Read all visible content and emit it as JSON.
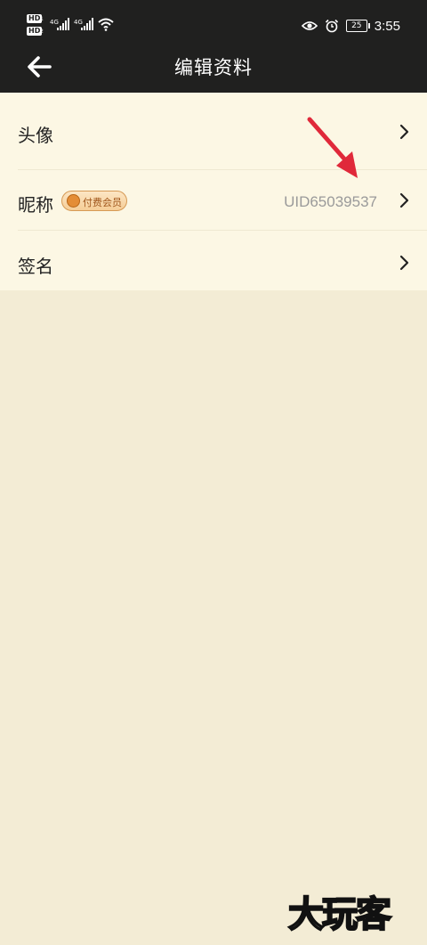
{
  "status_bar": {
    "hd1": "HD",
    "hd2": "HD",
    "sim1_slot": "1",
    "sim2_slot": "2",
    "network1": "4G",
    "network2": "4G",
    "battery": "25",
    "time": "3:55",
    "icons": [
      "signal-icon",
      "wifi-icon",
      "eye-icon",
      "alarm-icon",
      "battery-icon"
    ]
  },
  "header": {
    "title": "编辑资料",
    "back_icon": "back-arrow-icon"
  },
  "rows": [
    {
      "label": "头像",
      "icon": "chevron-right-icon"
    },
    {
      "label": "昵称",
      "badge": "付费会员",
      "value": "UID65039537",
      "icon": "chevron-right-icon"
    },
    {
      "label": "签名",
      "icon": "chevron-right-icon"
    }
  ],
  "annotation": {
    "icon": "red-arrow-icon",
    "color": "#e0293a"
  },
  "watermark": "大玩客",
  "colors": {
    "header_bg": "#20201f",
    "list_bg": "#fcf7e4",
    "page_bg": "#f3ecd5",
    "value_gray": "#9a9a9a"
  }
}
